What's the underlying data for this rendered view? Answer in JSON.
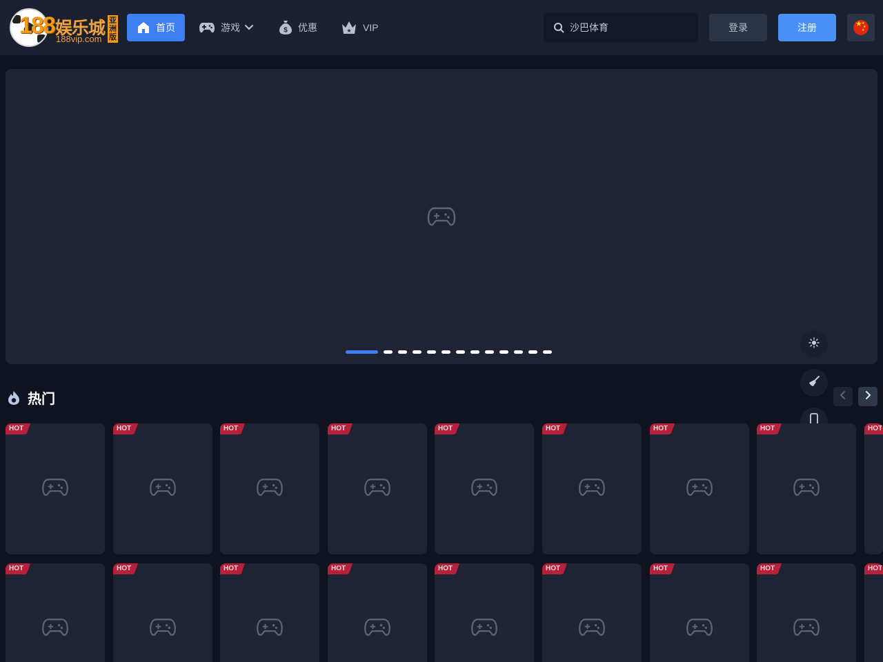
{
  "header": {
    "logo": {
      "number": "188",
      "name": "娱乐城",
      "url": "188vip.com",
      "tag": "亚洲版"
    },
    "nav": [
      {
        "label": "首页",
        "icon": "home-icon",
        "active": true
      },
      {
        "label": "游戏",
        "icon": "gamepad-icon",
        "has_dropdown": true
      },
      {
        "label": "优惠",
        "icon": "money-bag-icon"
      },
      {
        "label": "VIP",
        "icon": "crown-icon"
      }
    ],
    "search": {
      "text": "沙巴体育",
      "icon": "search-icon"
    },
    "login_label": "登录",
    "register_label": "注册",
    "language": {
      "icon": "china-flag-icon"
    }
  },
  "banner": {
    "placeholder_icon": "gamepad-icon",
    "slide_count": 13,
    "active_slide": 1
  },
  "side_tools": [
    {
      "name": "theme-toggle",
      "icon": "sun-icon"
    },
    {
      "name": "clean-cache",
      "icon": "broom-icon"
    },
    {
      "name": "mobile-app",
      "icon": "mobile-icon"
    },
    {
      "name": "customer-service",
      "icon": "headset-icon"
    },
    {
      "name": "back-to-top",
      "icon": "chevron-up-icon"
    }
  ],
  "section": {
    "title": "热门",
    "icon": "fire-icon"
  },
  "games": {
    "badge": "HOT",
    "placeholder_icon": "gamepad-icon",
    "rows": 2,
    "visible_per_row": 9
  },
  "colors": {
    "background": "#0f1320",
    "header": "#1b2030",
    "card": "#1f2434",
    "accent": "#3d7ef0",
    "register": "#4a8ff5",
    "hot_badge": "#b5203a",
    "logo_orange": "#f29a1c"
  }
}
